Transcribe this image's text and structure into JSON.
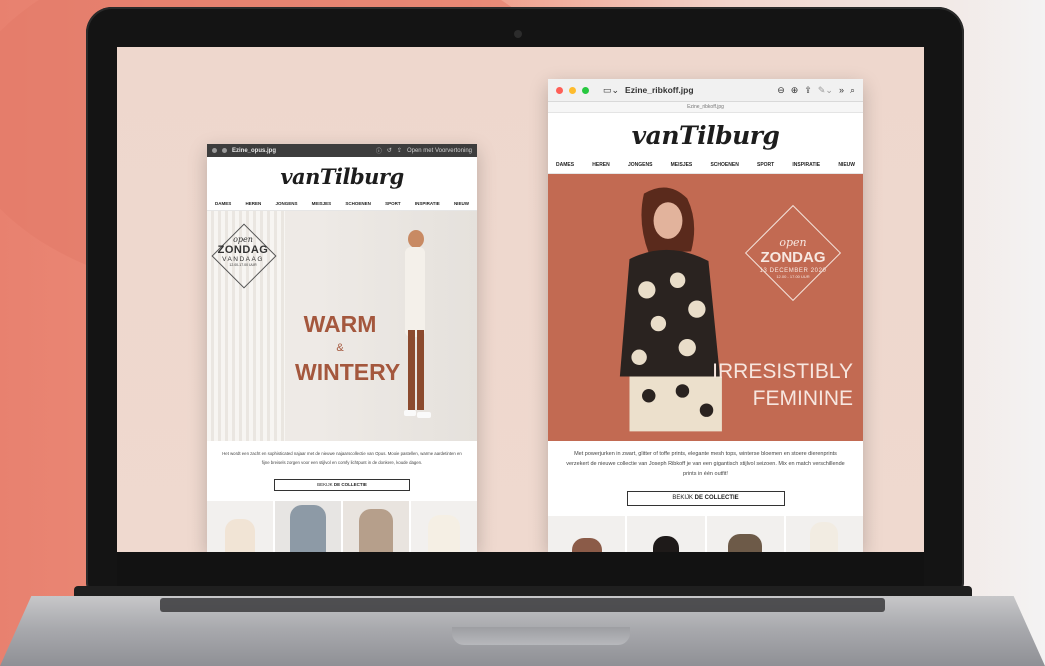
{
  "window_left": {
    "title": "Ezine_opus.jpg",
    "open_label": "Open met Voorvertoning",
    "brand": "vanTilburg",
    "nav": [
      "DAMES",
      "HEREN",
      "JONGENS",
      "MEISJES",
      "SCHOENEN",
      "SPORT",
      "INSPIRATIE",
      "NIEUW"
    ],
    "badge": {
      "line1": "open",
      "line2": "ZONDAG",
      "line3": "VANDAAG",
      "line4": "12.00-17.00 UUR"
    },
    "headline": {
      "line1": "WARM",
      "amp": "&",
      "line2": "WINTERY"
    },
    "body": "Het wordt een zacht en sophisticated najaar met de nieuwe najaarscollectie van Opus. Mooie pastellen, warme aardetinten en fijne breisels zorgen voor een stijlvol en comfy lichtpunt in de donkere, koude dagen.",
    "cta_prefix": "BEKIJK",
    "cta_strong": "DE COLLECTIE"
  },
  "window_right": {
    "title": "Ezine_ribkoff.jpg",
    "subtitle": "Ezine_ribkoff.jpg",
    "brand": "vanTilburg",
    "nav": [
      "DAMES",
      "HEREN",
      "JONGENS",
      "MEISJES",
      "SCHOENEN",
      "SPORT",
      "INSPIRATIE",
      "NIEUW"
    ],
    "badge": {
      "line1": "open",
      "line2": "ZONDAG",
      "line3": "13 DECEMBER 2020",
      "line4": "12.00 - 17.00 UUR"
    },
    "headline": {
      "line1": "IRRESISTIBLY",
      "line2": "FEMININE"
    },
    "body": "Met powerjurken in zwart, glitter of toffe prints, elegante mesh tops, winterse bloemen en stoere dierenprints verzekert de nieuwe collectie van Joseph Ribkoff je van een gigantisch stijlvol seizoen. Mix en match verschillende prints in één outfit!",
    "cta_prefix": "BEKIJK",
    "cta_strong": "DE COLLECTIE"
  },
  "colors": {
    "background": "#e8816f",
    "hero_right": "#c26a52",
    "headline_left": "#a4573d"
  }
}
